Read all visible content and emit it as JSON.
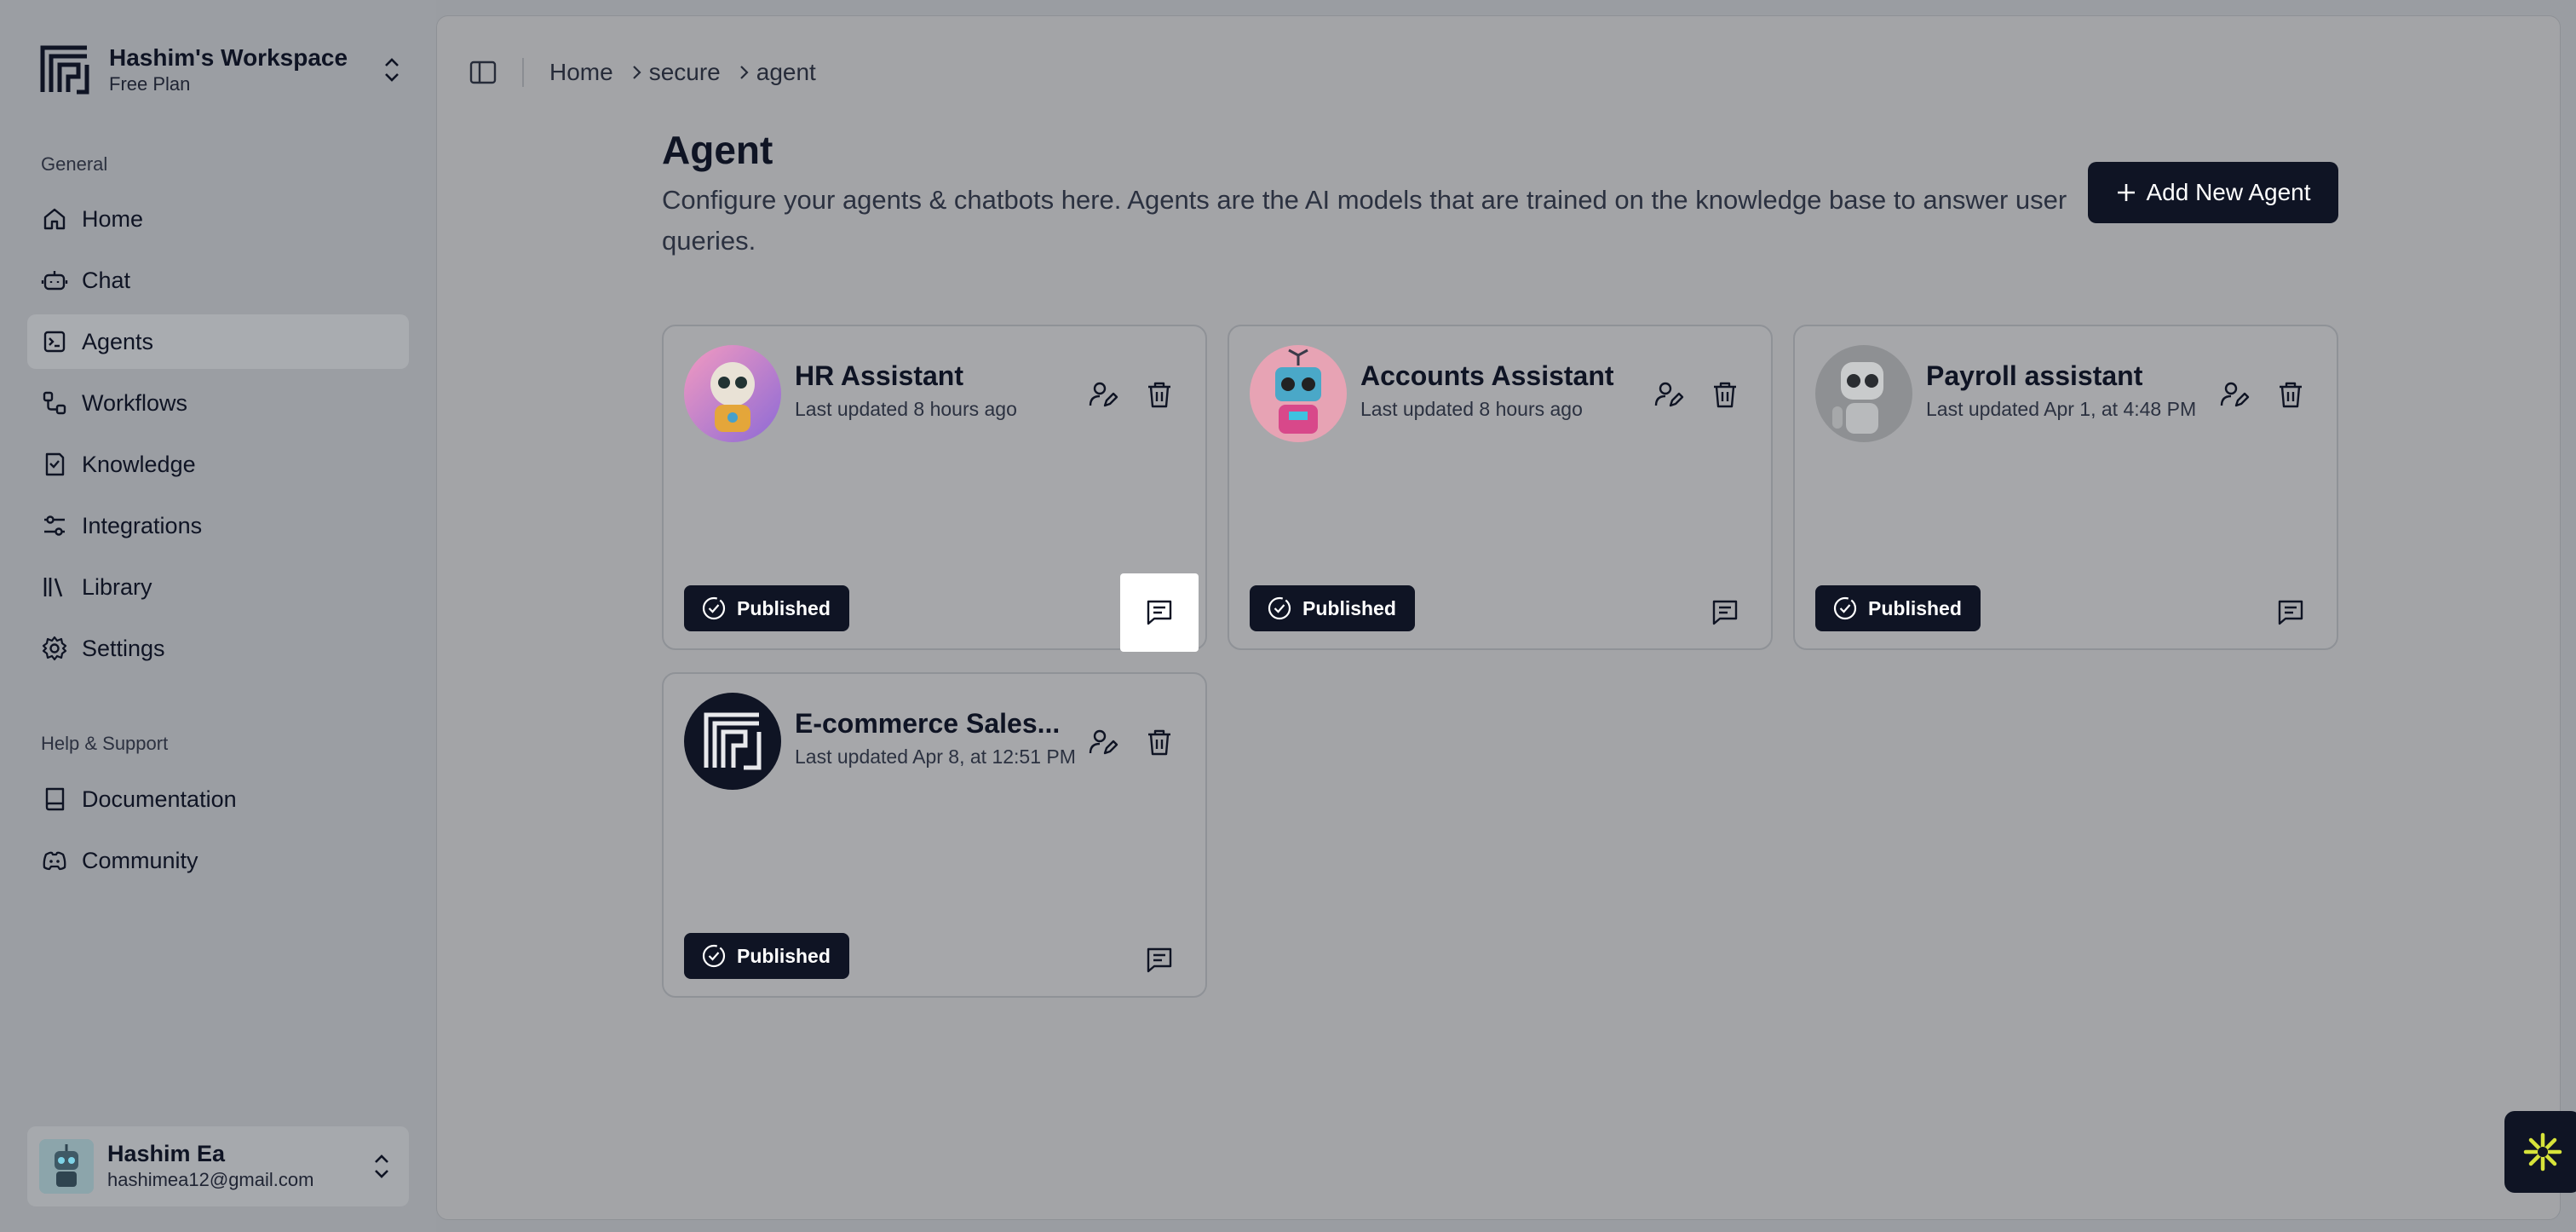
{
  "workspace": {
    "name": "Hashim's Workspace",
    "plan": "Free Plan"
  },
  "sidebar": {
    "section_general": "General",
    "items": [
      {
        "label": "Home",
        "icon": "home-icon"
      },
      {
        "label": "Chat",
        "icon": "bot-icon"
      },
      {
        "label": "Agents",
        "icon": "agents-icon",
        "active": true
      },
      {
        "label": "Workflows",
        "icon": "workflow-icon"
      },
      {
        "label": "Knowledge",
        "icon": "knowledge-icon"
      },
      {
        "label": "Integrations",
        "icon": "sliders-icon"
      },
      {
        "label": "Library",
        "icon": "library-icon"
      },
      {
        "label": "Settings",
        "icon": "gear-icon"
      }
    ],
    "section_help": "Help & Support",
    "help_items": [
      {
        "label": "Documentation",
        "icon": "book-icon"
      },
      {
        "label": "Community",
        "icon": "discord-icon"
      }
    ]
  },
  "user": {
    "name": "Hashim Ea",
    "email": "hashimea12@gmail.com"
  },
  "breadcrumb": [
    "Home",
    "secure",
    "agent"
  ],
  "page": {
    "title": "Agent",
    "description": "Configure your agents & chatbots here. Agents are the AI models that are trained on the knowledge base to answer user queries.",
    "add_button": "Add New Agent"
  },
  "agents": [
    {
      "name": "HR Assistant",
      "updated": "Last updated 8 hours ago",
      "status": "Published"
    },
    {
      "name": "Accounts Assistant",
      "updated": "Last updated 8 hours ago",
      "status": "Published"
    },
    {
      "name": "Payroll assistant",
      "updated": "Last updated Apr 1, at 4:48 PM",
      "status": "Published"
    },
    {
      "name": "E-commerce Sales...",
      "updated": "Last updated Apr 8, at 12:51 PM",
      "status": "Published"
    }
  ],
  "colors": {
    "primary": "#0f1424",
    "highlight": "#ffffff",
    "fab_accent": "#d7e33a"
  }
}
